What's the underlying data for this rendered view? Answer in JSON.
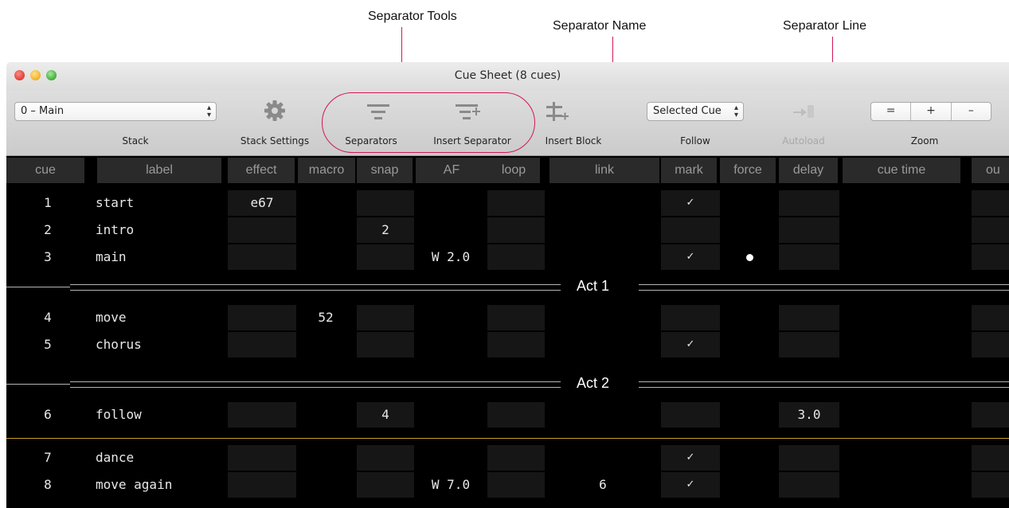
{
  "annotations": {
    "separator_tools": "Separator Tools",
    "separator_name": "Separator Name",
    "separator_line": "Separator Line",
    "accent_color": "#d4145a"
  },
  "window": {
    "title": "Cue Sheet (8 cues)"
  },
  "toolbar": {
    "stack_select_value": "0 – Main",
    "stack_label": "Stack",
    "stack_settings_label": "Stack Settings",
    "stack_settings_icon": "gear-icon",
    "separators_label": "Separators",
    "separators_icon": "separators-icon",
    "insert_separator_label": "Insert Separator",
    "insert_separator_icon": "insert-separator-icon",
    "insert_block_label": "Insert Block",
    "insert_block_icon": "insert-block-icon",
    "follow_select_value": "Selected Cue",
    "follow_label": "Follow",
    "autoload_label": "Autoload",
    "autoload_icon": "autoload-icon",
    "zoom_label": "Zoom",
    "zoom_buttons": [
      "=",
      "+",
      "–"
    ]
  },
  "columns": [
    "cue",
    "label",
    "effect",
    "macro",
    "snap",
    "AF",
    "loop",
    "link",
    "mark",
    "force",
    "delay",
    "cue time",
    "ou"
  ],
  "rows": {
    "r1": {
      "cue": "1",
      "label": "start",
      "effect": "e67",
      "mark": "✓"
    },
    "r2": {
      "cue": "2",
      "label": "intro",
      "snap": "2"
    },
    "r3": {
      "cue": "3",
      "label": "main",
      "af": "W 2.0",
      "mark": "✓"
    },
    "r4": {
      "cue": "4",
      "label": "move",
      "macro": "52"
    },
    "r5": {
      "cue": "5",
      "label": "chorus",
      "mark": "✓"
    },
    "r6": {
      "cue": "6",
      "label": "follow",
      "snap": "4",
      "delay": "3.0"
    },
    "r7": {
      "cue": "7",
      "label": "dance",
      "mark": "✓"
    },
    "r8": {
      "cue": "8",
      "label": "move again",
      "af": "W 7.0",
      "link": "6",
      "mark": "✓"
    }
  },
  "separators": [
    "Act 1",
    "Act 2"
  ],
  "colors": {
    "sheet_bg": "#000000",
    "follow_line": "#c8a020"
  }
}
